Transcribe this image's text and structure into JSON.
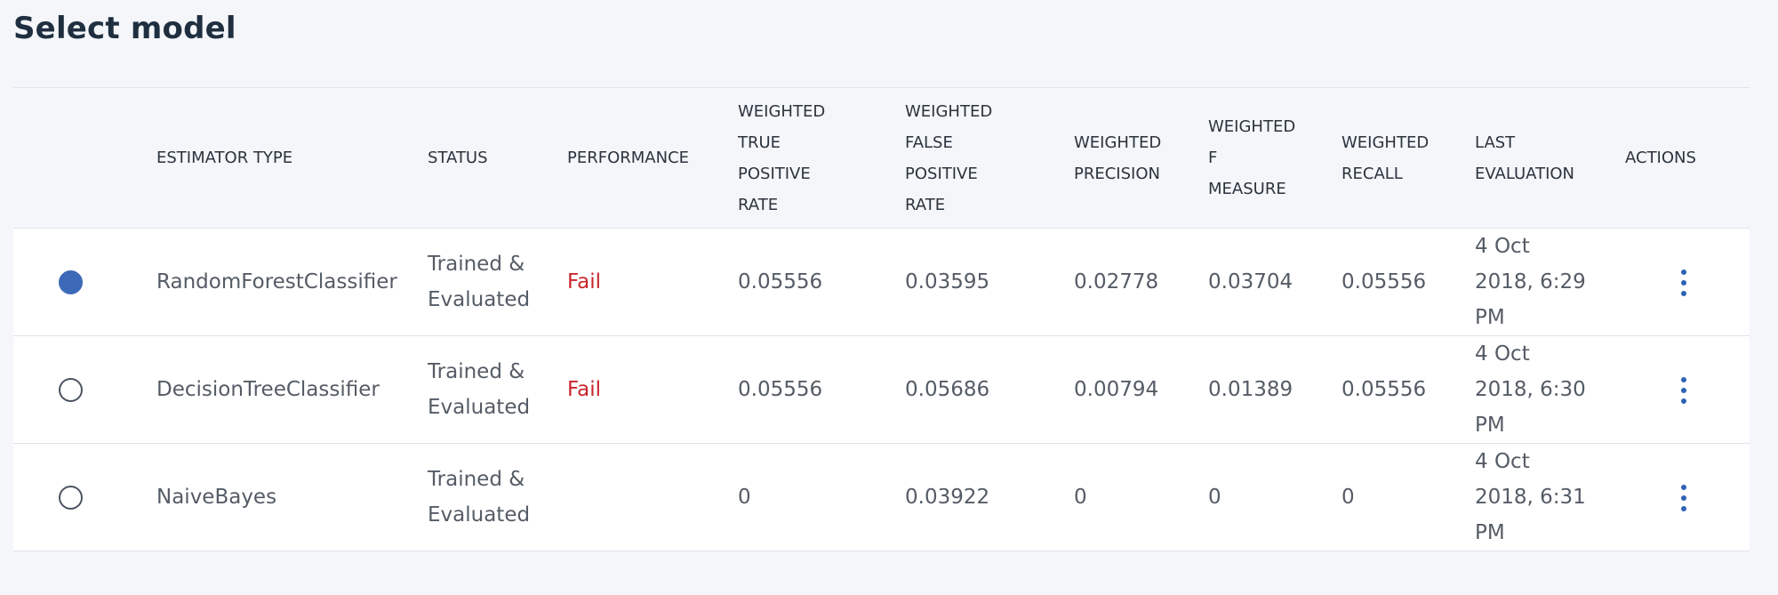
{
  "page": {
    "title": "Select model"
  },
  "table": {
    "columns": [
      "",
      "ESTIMATOR TYPE",
      "STATUS",
      "PERFORMANCE",
      "WEIGHTED\nTRUE\nPOSITIVE\nRATE",
      "WEIGHTED\nFALSE\nPOSITIVE\nRATE",
      "WEIGHTED\nPRECISION",
      "WEIGHTED\nF\nMEASURE",
      "WEIGHTED\nRECALL",
      "LAST\nEVALUATION",
      "ACTIONS"
    ],
    "rows": [
      {
        "selected": true,
        "estimator": "RandomForestClassifier",
        "status": "Trained &\nEvaluated",
        "performance": "Fail",
        "tpr": "0.05556",
        "fpr": "0.03595",
        "precision": "0.02778",
        "f_measure": "0.03704",
        "recall": "0.05556",
        "last_evaluation": "4 Oct\n2018, 6:29\nPM"
      },
      {
        "selected": false,
        "estimator": "DecisionTreeClassifier",
        "status": "Trained &\nEvaluated",
        "performance": "Fail",
        "tpr": "0.05556",
        "fpr": "0.05686",
        "precision": "0.00794",
        "f_measure": "0.01389",
        "recall": "0.05556",
        "last_evaluation": "4 Oct\n2018, 6:30\nPM"
      },
      {
        "selected": false,
        "estimator": "NaiveBayes",
        "status": "Trained &\nEvaluated",
        "performance": "",
        "tpr": "0",
        "fpr": "0.03922",
        "precision": "0",
        "f_measure": "0",
        "recall": "0",
        "last_evaluation": "4 Oct\n2018, 6:31\nPM"
      }
    ]
  },
  "colors": {
    "accent": "#3d6ab8",
    "fail": "#c9252c",
    "kebab": "#2d62b4",
    "background": "#f4f6fa"
  },
  "icons": {
    "row_action": "overflow-menu-vertical-icon",
    "row_select": "radio-button-icon"
  }
}
